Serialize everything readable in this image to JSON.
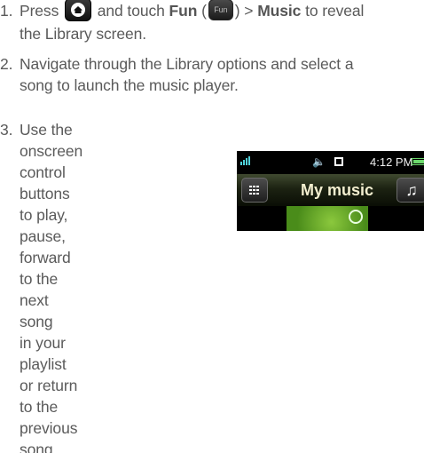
{
  "steps": [
    {
      "number": "1.",
      "line1_before": "Press",
      "line1_middle": "and touch",
      "fun_label": "Fun",
      "fun_icon_text": "Fun",
      "separator": ">",
      "music_label": "Music",
      "line1_after": "to reveal",
      "line2": "the Library screen."
    },
    {
      "number": "2.",
      "line1": "Navigate through the Library options and select a",
      "line2": "song to launch the music player."
    },
    {
      "number": "3.",
      "lines": [
        "Use the onscreen control",
        "buttons to play, pause,",
        "forward to the next song",
        "in your playlist or return",
        "to the previous song."
      ]
    }
  ],
  "phone": {
    "time": "4:12 PM",
    "title": "My music",
    "colors": {
      "signal": "#4fd1d9",
      "battery": "#6cd96c",
      "title": "#f2eecf"
    }
  }
}
